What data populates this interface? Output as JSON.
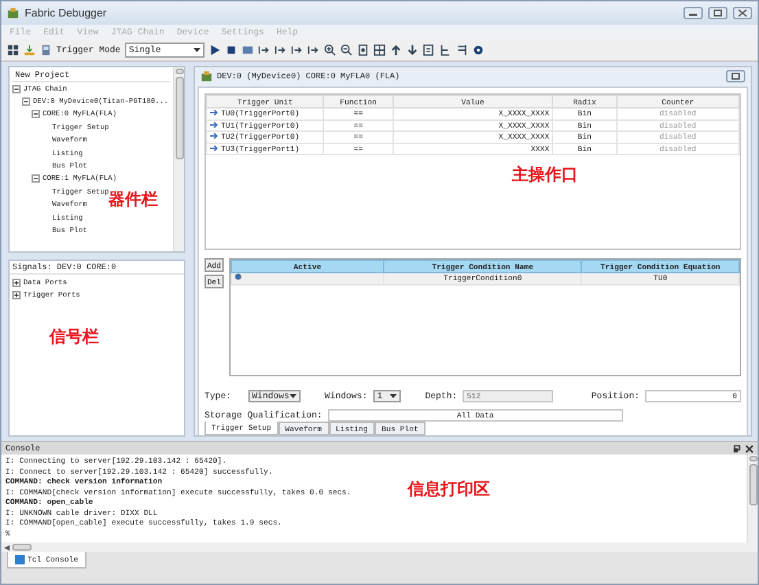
{
  "window": {
    "title": "Fabric Debugger"
  },
  "menu": [
    {
      "label": "File",
      "disabled": true
    },
    {
      "label": "Edit",
      "disabled": true
    },
    {
      "label": "View",
      "disabled": true
    },
    {
      "label": "JTAG Chain",
      "disabled": true
    },
    {
      "label": "Device",
      "disabled": true
    },
    {
      "label": "Settings",
      "disabled": true
    },
    {
      "label": "Help",
      "disabled": true
    }
  ],
  "toolbar": {
    "mode_label": "Trigger Mode",
    "mode_value": "Single"
  },
  "project": {
    "title": "New Project",
    "tree": [
      {
        "label": "JTAG Chain",
        "expanded": true,
        "children": [
          {
            "label": "DEV:0 MyDevice0(Titan-PGT180...",
            "expanded": true,
            "children": [
              {
                "label": "CORE:0 MyFLA(FLA)",
                "expanded": true,
                "children": [
                  {
                    "label": "Trigger Setup"
                  },
                  {
                    "label": "Waveform"
                  },
                  {
                    "label": "Listing"
                  },
                  {
                    "label": "Bus Plot"
                  }
                ]
              },
              {
                "label": "CORE:1 MyFLA(FLA)",
                "expanded": true,
                "children": [
                  {
                    "label": "Trigger Setup"
                  },
                  {
                    "label": "Waveform"
                  },
                  {
                    "label": "Listing"
                  },
                  {
                    "label": "Bus Plot"
                  }
                ]
              }
            ]
          }
        ]
      }
    ]
  },
  "signals": {
    "title": "Signals: DEV:0 CORE:0",
    "items": [
      {
        "label": "Data Ports",
        "expanded": false
      },
      {
        "label": "Trigger Ports",
        "expanded": false
      }
    ]
  },
  "core": {
    "title": "DEV:0 (MyDevice0) CORE:0 MyFLA0 (FLA)",
    "trigger_table": {
      "columns": [
        "Trigger Unit",
        "Function",
        "Value",
        "Radix",
        "Counter"
      ],
      "rows": [
        [
          "TU0(TriggerPort0)",
          "==",
          "X_XXXX_XXXX",
          "Bin",
          "disabled"
        ],
        [
          "TU1(TriggerPort0)",
          "==",
          "X_XXXX_XXXX",
          "Bin",
          "disabled"
        ],
        [
          "TU2(TriggerPort0)",
          "==",
          "X_XXXX_XXXX",
          "Bin",
          "disabled"
        ],
        [
          "TU3(TriggerPort1)",
          "==",
          "XXXX",
          "Bin",
          "disabled"
        ]
      ]
    },
    "buttons": [
      "Add",
      "Del"
    ],
    "condition_table": {
      "columns": [
        "Active",
        "Trigger Condition Name",
        "Trigger Condition Equation"
      ],
      "rows": [
        {
          "active": true,
          "name": "TriggerCondition0",
          "equation": "TU0"
        }
      ]
    },
    "type": {
      "label": "Type:",
      "value": "Windows"
    },
    "windows": {
      "label": "Windows:",
      "value": "1"
    },
    "depth": {
      "label": "Depth:",
      "value": "512",
      "disabled": true
    },
    "position": {
      "label": "Position:",
      "value": "0"
    },
    "storage": {
      "label": "Storage Qualification:",
      "value": "All Data"
    },
    "tabs": [
      {
        "label": "Trigger Setup",
        "selected": true
      },
      {
        "label": "Waveform",
        "selected": false
      },
      {
        "label": "Listing",
        "selected": false
      },
      {
        "label": "Bus Plot",
        "selected": false
      }
    ]
  },
  "console": {
    "title": "Console",
    "lines": [
      {
        "text": "I: Connecting to server[192.29.103.142 : 65420].",
        "bold": false
      },
      {
        "text": "I: Connect to server[192.29.103.142 : 65420] successfully.",
        "bold": false
      },
      {
        "text": "COMMAND: check version information",
        "bold": true
      },
      {
        "text": "I: COMMAND[check version information] execute successfully, takes 0.0 secs.",
        "bold": false
      },
      {
        "text": "COMMAND: open_cable",
        "bold": true
      },
      {
        "text": "I: UNKNOWN cable driver: DIXX DLL",
        "bold": false
      },
      {
        "text": "I: COMMAND[open_cable] execute successfully, takes 1.9 secs.",
        "bold": false
      },
      {
        "text": "%",
        "bold": false
      }
    ],
    "tabs": [
      {
        "label": "Tcl Console",
        "selected": true
      }
    ]
  },
  "annotations": [
    {
      "text": "器件栏"
    },
    {
      "text": "主操作口"
    },
    {
      "text": "信号栏"
    },
    {
      "text": "信息打印区"
    }
  ]
}
